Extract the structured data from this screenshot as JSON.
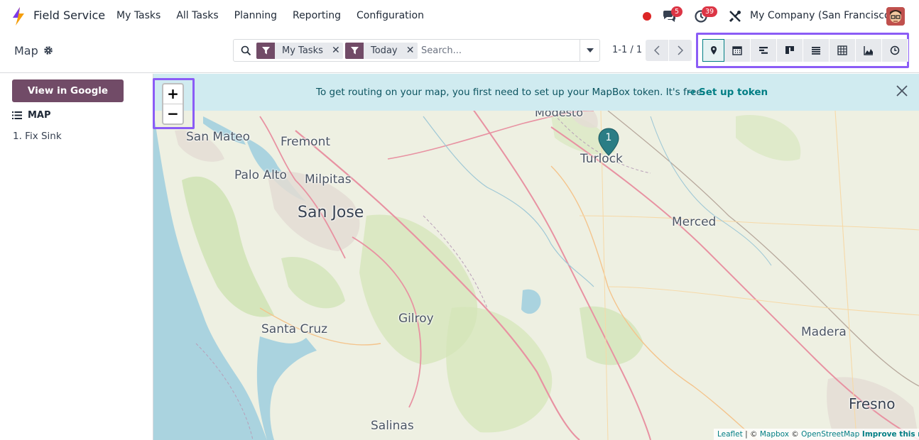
{
  "navbar": {
    "app_name": "Field Service",
    "menu": [
      "My Tasks",
      "All Tasks",
      "Planning",
      "Reporting",
      "Configuration"
    ],
    "chat_count": "5",
    "activity_count": "39",
    "company": "My Company (San Francisco)"
  },
  "control_panel": {
    "breadcrumb": "Map",
    "facets": [
      {
        "label": "My Tasks"
      },
      {
        "label": "Today"
      }
    ],
    "search_placeholder": "Search...",
    "pager": "1-1 / 1",
    "views": [
      "map",
      "calendar",
      "gantt",
      "kanban",
      "list",
      "pivot",
      "graph",
      "activity"
    ],
    "active_view": "map"
  },
  "sidebar": {
    "google_maps_button": "View in Google Maps",
    "section_title": "MAP",
    "records": [
      "1. Fix Sink"
    ]
  },
  "map": {
    "banner_text": "To get routing on your map, you first need to set up your MapBox token. It's free.",
    "banner_link": "➔ Set up token",
    "zoom_in": "+",
    "zoom_out": "−",
    "marker_number": "1",
    "cities": [
      "Modesto",
      "San Mateo",
      "Fremont",
      "Turlock",
      "Palo Alto",
      "Milpitas",
      "San Jose",
      "Merced",
      "Gilroy",
      "Santa Cruz",
      "Madera",
      "Fresno",
      "Salinas"
    ],
    "attribution": {
      "leaflet": "Leaflet",
      "sep1": " | © ",
      "mapbox": "Mapbox",
      "sep2": " © ",
      "osm": "OpenStreetMap",
      "improve": " Improve this map"
    }
  }
}
